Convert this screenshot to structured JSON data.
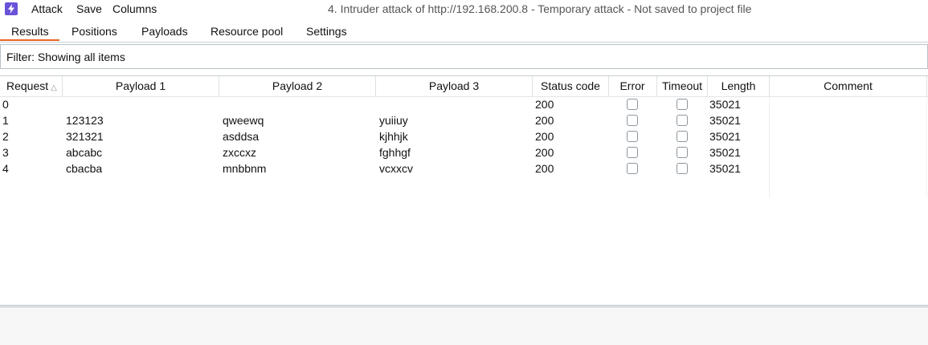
{
  "menu": {
    "items": [
      "Attack",
      "Save",
      "Columns"
    ]
  },
  "window": {
    "title": "4. Intruder attack of http://192.168.200.8 - Temporary attack - Not saved to project file"
  },
  "tabs": [
    {
      "label": "Results",
      "active": true
    },
    {
      "label": "Positions",
      "active": false
    },
    {
      "label": "Payloads",
      "active": false
    },
    {
      "label": "Resource pool",
      "active": false
    },
    {
      "label": "Settings",
      "active": false
    }
  ],
  "filter": {
    "label": "Filter: Showing all items"
  },
  "table": {
    "columns": [
      "Request",
      "Payload 1",
      "Payload 2",
      "Payload 3",
      "Status code",
      "Error",
      "Timeout",
      "Length",
      "Comment"
    ],
    "sort": {
      "column": "Request",
      "direction": "ascending"
    },
    "rows": [
      {
        "request": "0",
        "p1": "",
        "p2": "",
        "p3": "",
        "status": "200",
        "error": false,
        "timeout": false,
        "length": "35021",
        "comment": ""
      },
      {
        "request": "1",
        "p1": "123123",
        "p2": "qweewq",
        "p3": "yuiiuy",
        "status": "200",
        "error": false,
        "timeout": false,
        "length": "35021",
        "comment": ""
      },
      {
        "request": "2",
        "p1": "321321",
        "p2": "asddsa",
        "p3": "kjhhjk",
        "status": "200",
        "error": false,
        "timeout": false,
        "length": "35021",
        "comment": ""
      },
      {
        "request": "3",
        "p1": "abcabc",
        "p2": "zxccxz",
        "p3": "fghhgf",
        "status": "200",
        "error": false,
        "timeout": false,
        "length": "35021",
        "comment": ""
      },
      {
        "request": "4",
        "p1": "cbacba",
        "p2": "mnbbnm",
        "p3": "vcxxcv",
        "status": "200",
        "error": false,
        "timeout": false,
        "length": "35021",
        "comment": ""
      }
    ]
  },
  "colors": {
    "accent": "#e8661f",
    "app_icon": "#6a52d9"
  }
}
